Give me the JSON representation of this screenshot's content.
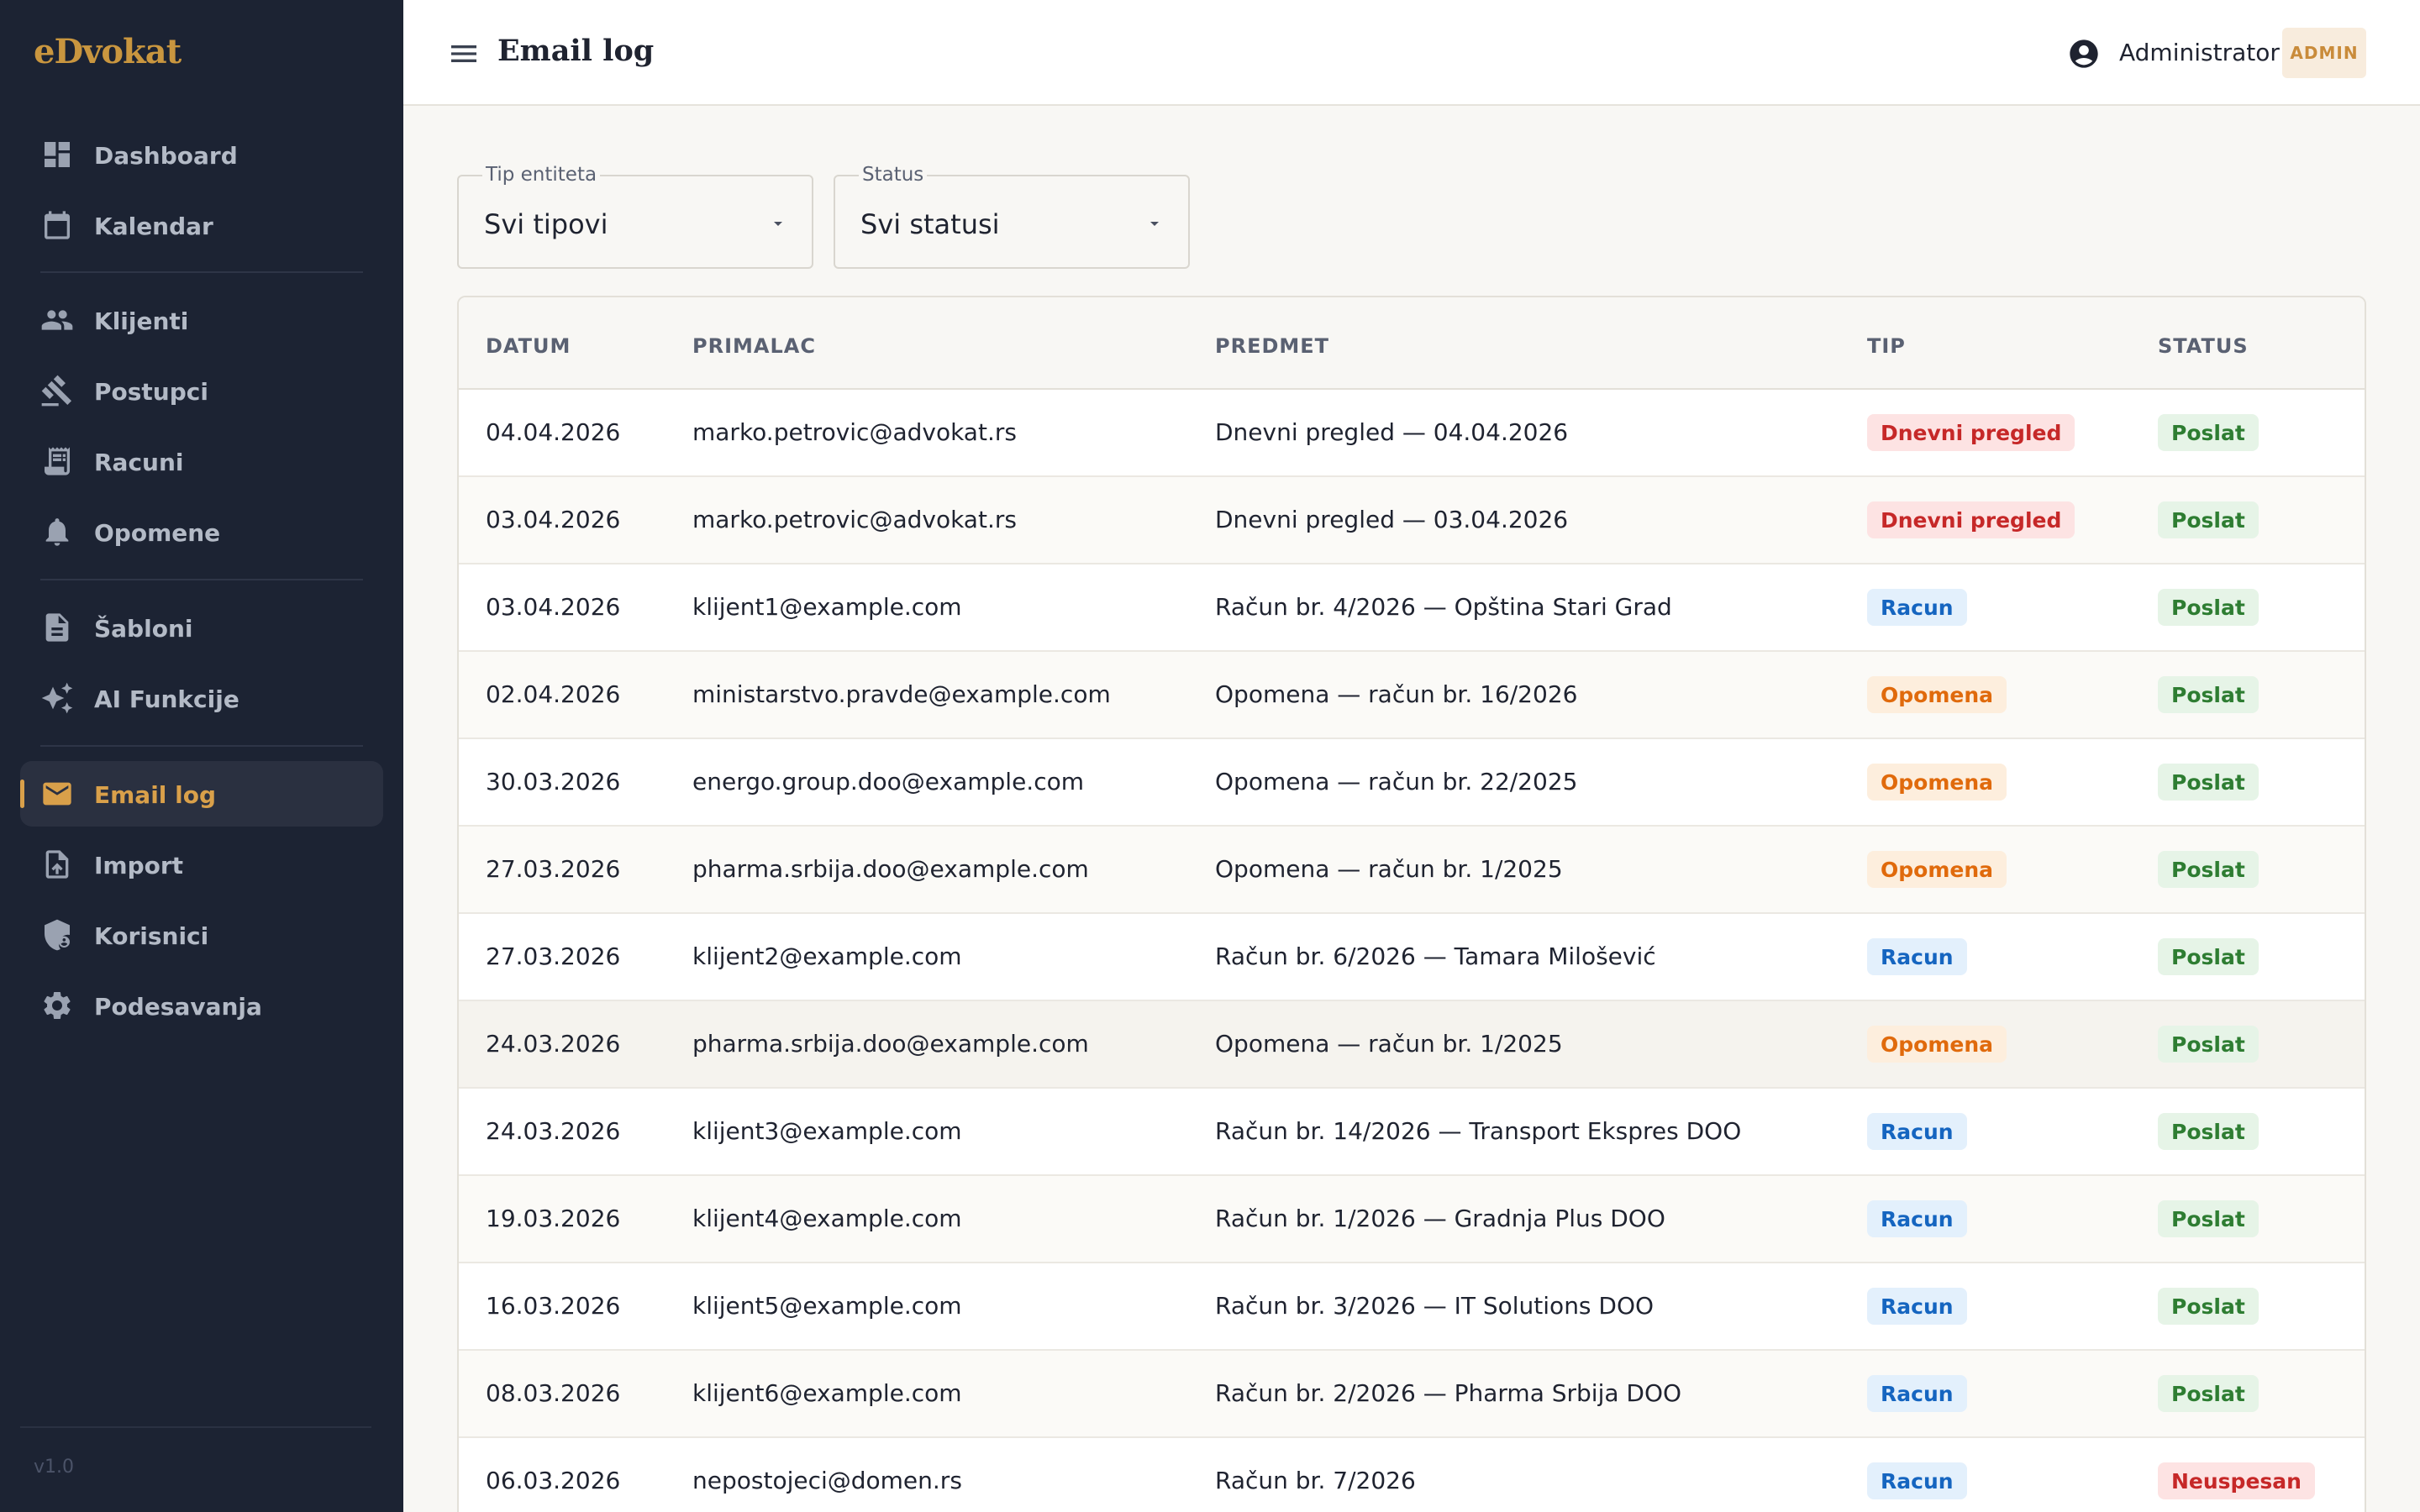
{
  "app": {
    "logo": "eDvokat",
    "version": "v1.0"
  },
  "sidebar": {
    "items": [
      {
        "label": "Dashboard",
        "icon": "dashboard-icon"
      },
      {
        "label": "Kalendar",
        "icon": "calendar-icon"
      },
      {
        "label": "Klijenti",
        "icon": "people-icon"
      },
      {
        "label": "Postupci",
        "icon": "gavel-icon"
      },
      {
        "label": "Racuni",
        "icon": "receipt-icon"
      },
      {
        "label": "Opomene",
        "icon": "bell-icon"
      },
      {
        "label": "Šabloni",
        "icon": "document-icon"
      },
      {
        "label": "AI Funkcije",
        "icon": "sparkle-icon"
      },
      {
        "label": "Email log",
        "icon": "mail-icon",
        "active": true
      },
      {
        "label": "Import",
        "icon": "file-upload-icon"
      },
      {
        "label": "Korisnici",
        "icon": "admin-shield-icon"
      },
      {
        "label": "Podesavanja",
        "icon": "gear-icon"
      }
    ]
  },
  "header": {
    "title": "Email log",
    "user_name": "Administrator",
    "role_badge": "ADMIN"
  },
  "filters": {
    "entity_type": {
      "label": "Tip entiteta",
      "value": "Svi tipovi"
    },
    "status": {
      "label": "Status",
      "value": "Svi statusi"
    }
  },
  "table": {
    "columns": [
      "DATUM",
      "PRIMALAC",
      "PREDMET",
      "TIP",
      "STATUS"
    ],
    "rows": [
      {
        "datum": "04.04.2026",
        "primalac": "marko.petrovic@advokat.rs",
        "predmet": "Dnevni pregled — 04.04.2026",
        "tip": "Dnevni pregled",
        "status": "Poslat"
      },
      {
        "datum": "03.04.2026",
        "primalac": "marko.petrovic@advokat.rs",
        "predmet": "Dnevni pregled — 03.04.2026",
        "tip": "Dnevni pregled",
        "status": "Poslat"
      },
      {
        "datum": "03.04.2026",
        "primalac": "klijent1@example.com",
        "predmet": "Račun br. 4/2026 — Opština Stari Grad",
        "tip": "Racun",
        "status": "Poslat"
      },
      {
        "datum": "02.04.2026",
        "primalac": "ministarstvo.pravde@example.com",
        "predmet": "Opomena — račun br. 16/2026",
        "tip": "Opomena",
        "status": "Poslat"
      },
      {
        "datum": "30.03.2026",
        "primalac": "energo.group.doo@example.com",
        "predmet": "Opomena — račun br. 22/2025",
        "tip": "Opomena",
        "status": "Poslat"
      },
      {
        "datum": "27.03.2026",
        "primalac": "pharma.srbija.doo@example.com",
        "predmet": "Opomena — račun br. 1/2025",
        "tip": "Opomena",
        "status": "Poslat"
      },
      {
        "datum": "27.03.2026",
        "primalac": "klijent2@example.com",
        "predmet": "Račun br. 6/2026 — Tamara Milošević",
        "tip": "Racun",
        "status": "Poslat"
      },
      {
        "datum": "24.03.2026",
        "primalac": "pharma.srbija.doo@example.com",
        "predmet": "Opomena — račun br. 1/2025",
        "tip": "Opomena",
        "status": "Poslat"
      },
      {
        "datum": "24.03.2026",
        "primalac": "klijent3@example.com",
        "predmet": "Račun br. 14/2026 — Transport Ekspres DOO",
        "tip": "Racun",
        "status": "Poslat"
      },
      {
        "datum": "19.03.2026",
        "primalac": "klijent4@example.com",
        "predmet": "Račun br. 1/2026 — Gradnja Plus DOO",
        "tip": "Racun",
        "status": "Poslat"
      },
      {
        "datum": "16.03.2026",
        "primalac": "klijent5@example.com",
        "predmet": "Račun br. 3/2026 — IT Solutions DOO",
        "tip": "Racun",
        "status": "Poslat"
      },
      {
        "datum": "08.03.2026",
        "primalac": "klijent6@example.com",
        "predmet": "Račun br. 2/2026 — Pharma Srbija DOO",
        "tip": "Racun",
        "status": "Poslat"
      },
      {
        "datum": "06.03.2026",
        "primalac": "nepostojeci@domen.rs",
        "predmet": "Račun br. 7/2026",
        "tip": "Racun",
        "status": "Neuspesan"
      }
    ]
  },
  "colors": {
    "sidebar_bg": "#1c2333",
    "accent": "#d9a04a",
    "page_bg": "#f8f7f4"
  }
}
